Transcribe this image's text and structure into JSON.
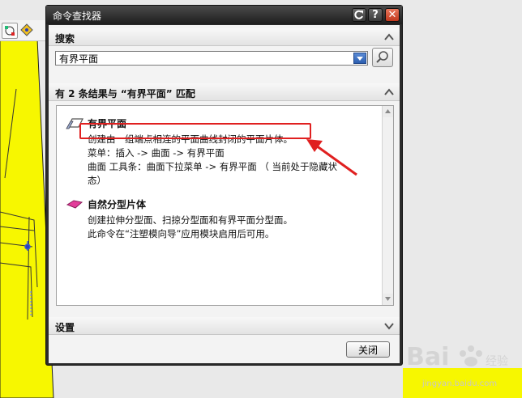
{
  "dialog": {
    "title": "命令查找器",
    "search_section": {
      "heading": "搜索",
      "input_value": "有界平面"
    },
    "results_section": {
      "heading": "有 2 条结果与 “有界平面” 匹配",
      "results": [
        {
          "title": "有界平面",
          "icon": "bounded-plane-icon",
          "lines": [
            "创建由一组端点相连的平面曲线封闭的平面片体。",
            "菜单：插入 -> 曲面 -> 有界平面",
            "曲面 工具条：曲面下拉菜单 -> 有界平面 （ 当前处于隐藏状",
            "态）"
          ]
        },
        {
          "title": "自然分型片体",
          "icon": "parting-sheet-icon",
          "lines": [
            "创建拉伸分型面、扫掠分型面和有界平面分型面。",
            "此命令在“注塑模向导”应用模块启用后可用。"
          ]
        }
      ]
    },
    "settings_section": {
      "heading": "设置"
    },
    "close_button": "关闭"
  },
  "watermark": {
    "text": "jingyan.baidu.com"
  },
  "colors": {
    "annotation_red": "#e02020",
    "cad_surface_yellow": "#f7f700",
    "title_bar_dark": "#2b2b2b"
  }
}
